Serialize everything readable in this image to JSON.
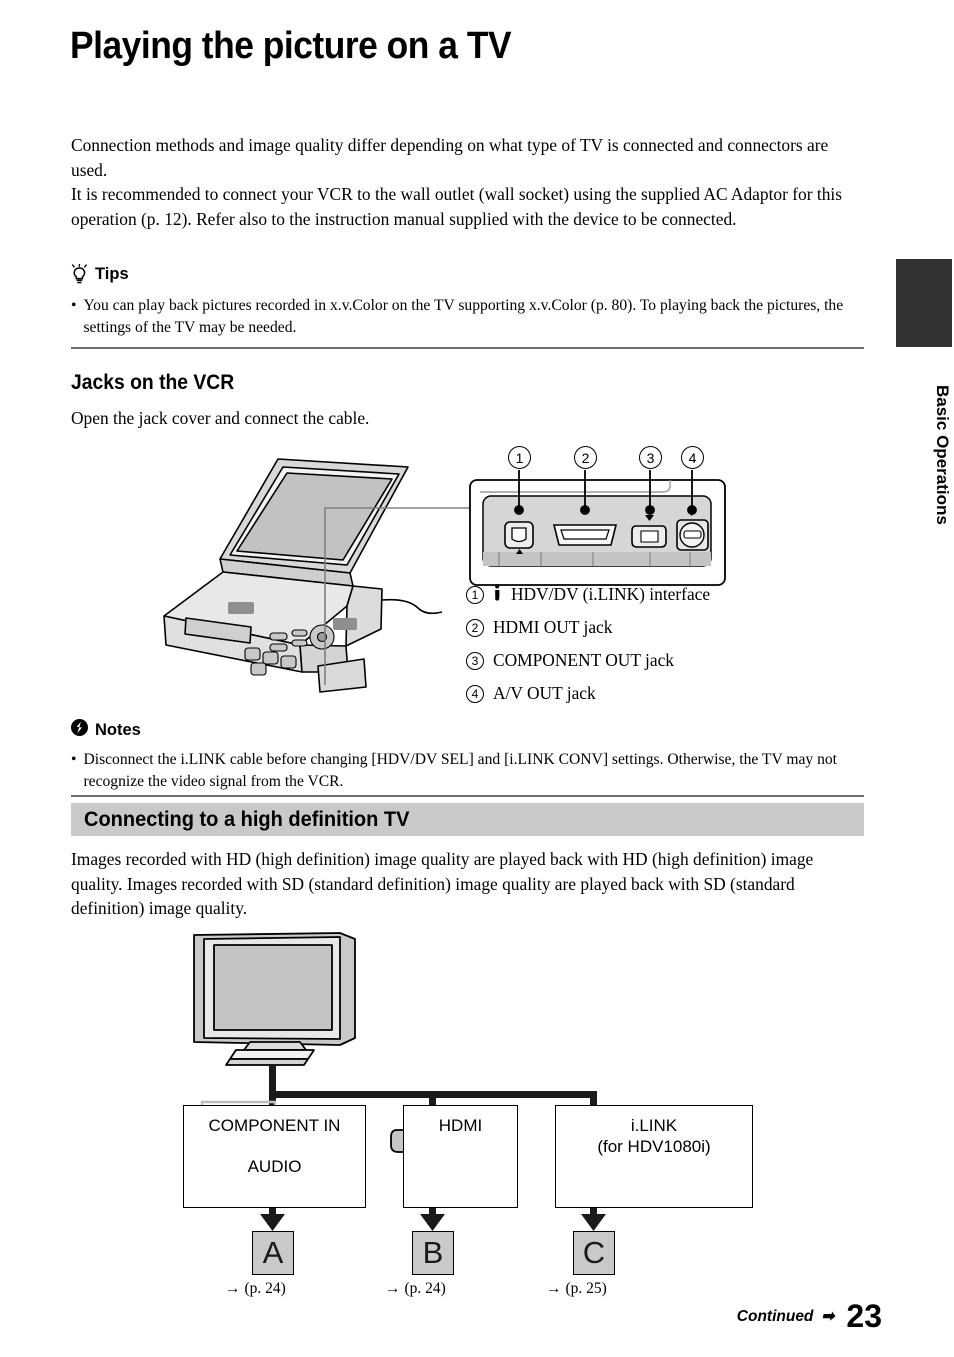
{
  "title": "Playing the picture on a TV",
  "intro": {
    "para1": "Connection methods and image quality differ depending on what type of TV is connected and connectors are used.",
    "para2": "It is recommended to connect your VCR to the wall outlet (wall socket) using the supplied AC Adaptor for this operation (p. 12). Refer also to the instruction manual supplied with the device to be connected."
  },
  "tips": {
    "icon": "lightbulb-icon",
    "heading": "Tips",
    "bullet": "•",
    "text": "You can play back pictures recorded in x.v.Color on the TV supporting x.v.Color (p. 80). To playing back the pictures, the settings of the TV may be needed."
  },
  "jacks_section": {
    "heading": "Jacks on the VCR",
    "instruction": "Open the jack cover and connect the cable.",
    "callout_numbers": [
      "1",
      "2",
      "3",
      "4"
    ],
    "items": [
      {
        "num": "1",
        "icon": "ilink-icon",
        "label": "HDV/DV (i.LINK) interface"
      },
      {
        "num": "2",
        "icon": "",
        "label": "HDMI OUT jack"
      },
      {
        "num": "3",
        "icon": "",
        "label": "COMPONENT OUT jack"
      },
      {
        "num": "4",
        "icon": "",
        "label": "A/V OUT jack"
      }
    ]
  },
  "notes": {
    "icon": "notes-alert-icon",
    "heading": "Notes",
    "bullet": "•",
    "text": "Disconnect the i.LINK cable before changing [HDV/DV SEL] and [i.LINK CONV] settings. Otherwise, the TV may not recognize the video signal from the VCR."
  },
  "hd_section": {
    "heading": "Connecting to a high definition TV",
    "body": "Images recorded with HD (high definition) image quality are played back with HD (high definition) image quality. Images recorded with SD (standard definition) image quality are played back with SD (standard definition) image quality."
  },
  "tv_diagram": {
    "device": "television-illustration",
    "connections": [
      {
        "id": "component",
        "title_line1": "COMPONENT IN",
        "title_line2": "AUDIO",
        "jacks_video": [
          "green",
          "blue",
          "red"
        ],
        "jacks_audio": [
          "white",
          "red"
        ],
        "ref_letter": "A",
        "ref_page": "(p. 24)"
      },
      {
        "id": "hdmi",
        "title_line1": "HDMI",
        "title_line2": "",
        "ref_letter": "B",
        "ref_page": "(p. 24)"
      },
      {
        "id": "ilink",
        "title_line1": "i.LINK",
        "title_line2": "(for HDV1080i)",
        "ref_letter": "C",
        "ref_page": "(p. 25)"
      }
    ],
    "arrow_glyph": "→"
  },
  "side_tab": {
    "label": "Basic Operations"
  },
  "footer": {
    "continued": "Continued",
    "arrow": "➡",
    "page_number": "23"
  }
}
